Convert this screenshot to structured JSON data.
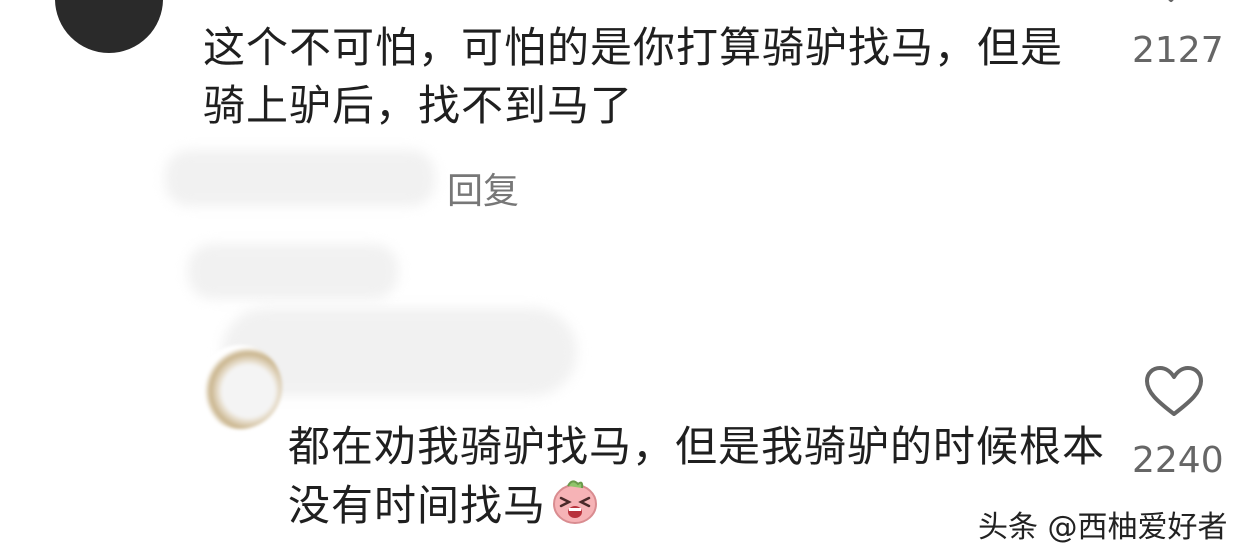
{
  "comments": [
    {
      "text": "这个不可怕，可怕的是你打算骑驴找马，但是骑上驴后，找不到马了",
      "likes": "2127",
      "reply_label": "回复"
    },
    {
      "text": "都在劝我骑驴找马，但是我骑驴的时候根本没有时间找马",
      "likes": "2240",
      "emoji": "laughing-crying-face-icon"
    }
  ],
  "watermark": "头条 @西柚爱好者",
  "icons": {
    "like": "heart-outline-icon"
  },
  "colors": {
    "text": "#1f1f1f",
    "meta": "#666666",
    "reply": "#777777",
    "heart": "#666666",
    "emoji": "#f2a0a8"
  }
}
